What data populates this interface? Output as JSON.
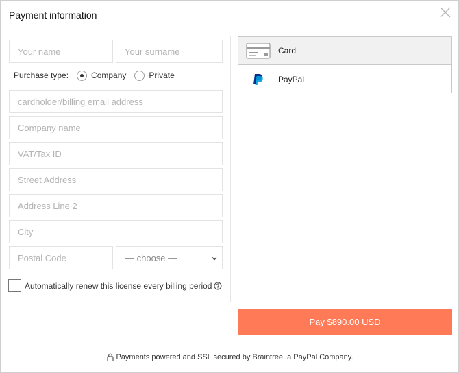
{
  "dialog": {
    "title": "Payment information"
  },
  "form": {
    "first_name_placeholder": "Your name",
    "surname_placeholder": "Your surname",
    "purchase_type_label": "Purchase type:",
    "purchase_type_options": [
      "Company",
      "Private"
    ],
    "purchase_type_selected": "Company",
    "email_placeholder": "cardholder/billing email address",
    "company_placeholder": "Company name",
    "vat_placeholder": "VAT/Tax ID",
    "street_placeholder": "Street Address",
    "address2_placeholder": "Address Line 2",
    "city_placeholder": "City",
    "postal_placeholder": "Postal Code",
    "country_select_value": "— choose —",
    "renew_label": "Automatically renew this license every billing period",
    "renew_checked": false
  },
  "payment_methods": [
    {
      "label": "Card",
      "icon": "credit-card-icon",
      "selected": true
    },
    {
      "label": "PayPal",
      "icon": "paypal-icon",
      "selected": false
    }
  ],
  "pay_button_label": "Pay $890.00 USD",
  "security_note": "Payments powered and SSL secured by Braintree, a PayPal Company.",
  "colors": {
    "pay_button": "#ff7a57",
    "paypal_dark": "#003087",
    "paypal_light": "#009cde"
  }
}
